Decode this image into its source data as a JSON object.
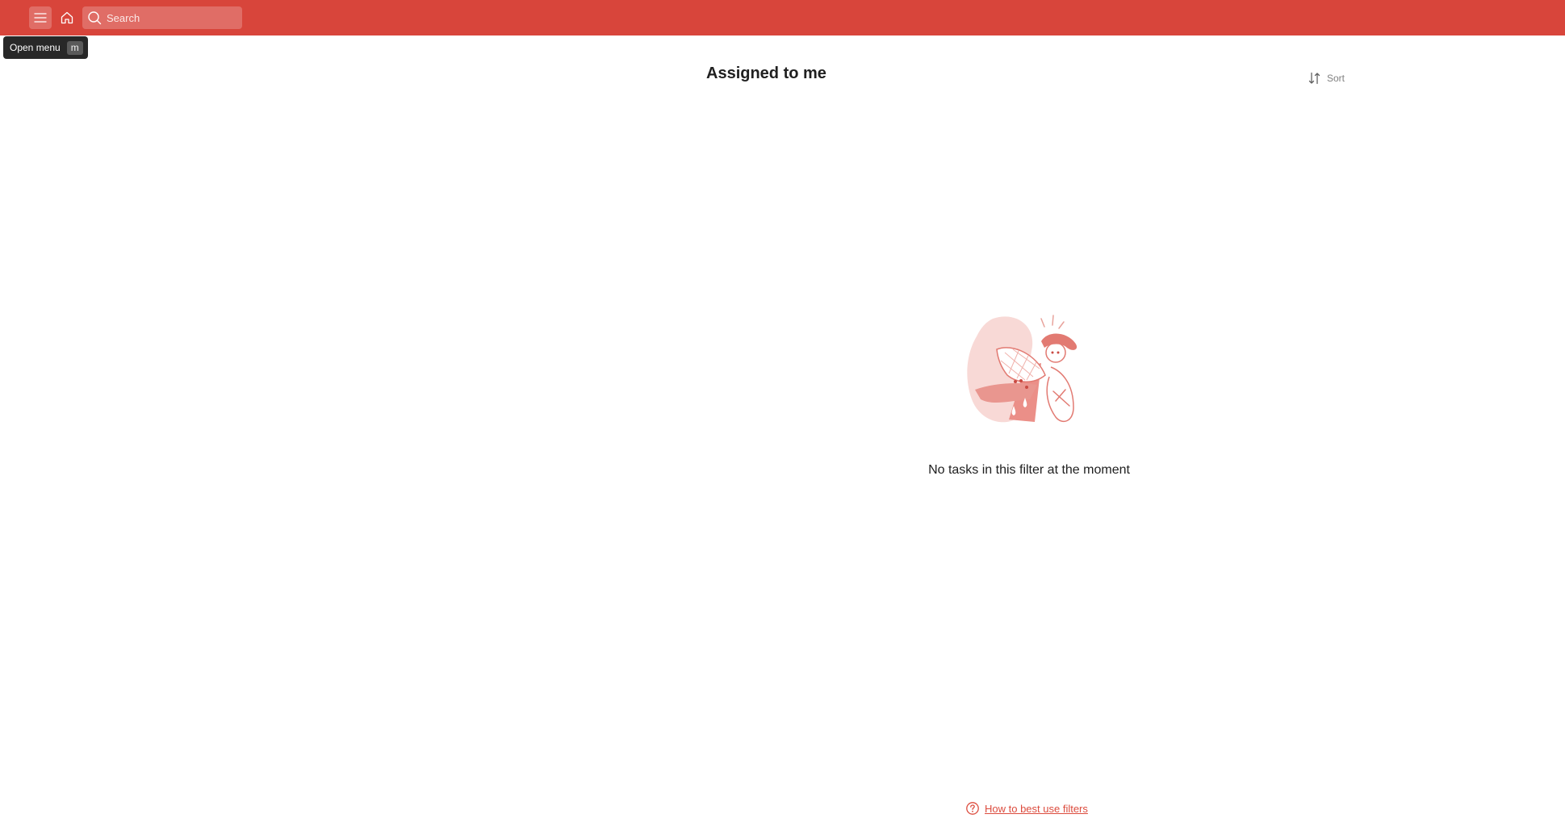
{
  "topbar": {
    "menu_icon": "hamburger-icon",
    "home_icon": "home-icon",
    "search": {
      "icon": "search-icon",
      "placeholder": "Search",
      "value": ""
    },
    "accent_color": "#d8453b"
  },
  "tooltip": {
    "label": "Open menu",
    "shortcut": "m"
  },
  "main": {
    "title": "Assigned to me",
    "sort": {
      "icon": "sort-icon",
      "label": "Sort"
    },
    "empty_state": {
      "illustration": "empty-filter-illustration",
      "message": "No tasks in this filter at the moment"
    },
    "help": {
      "icon": "question-circle-icon",
      "label": "How to best use filters",
      "color": "#dc4c3e"
    }
  }
}
